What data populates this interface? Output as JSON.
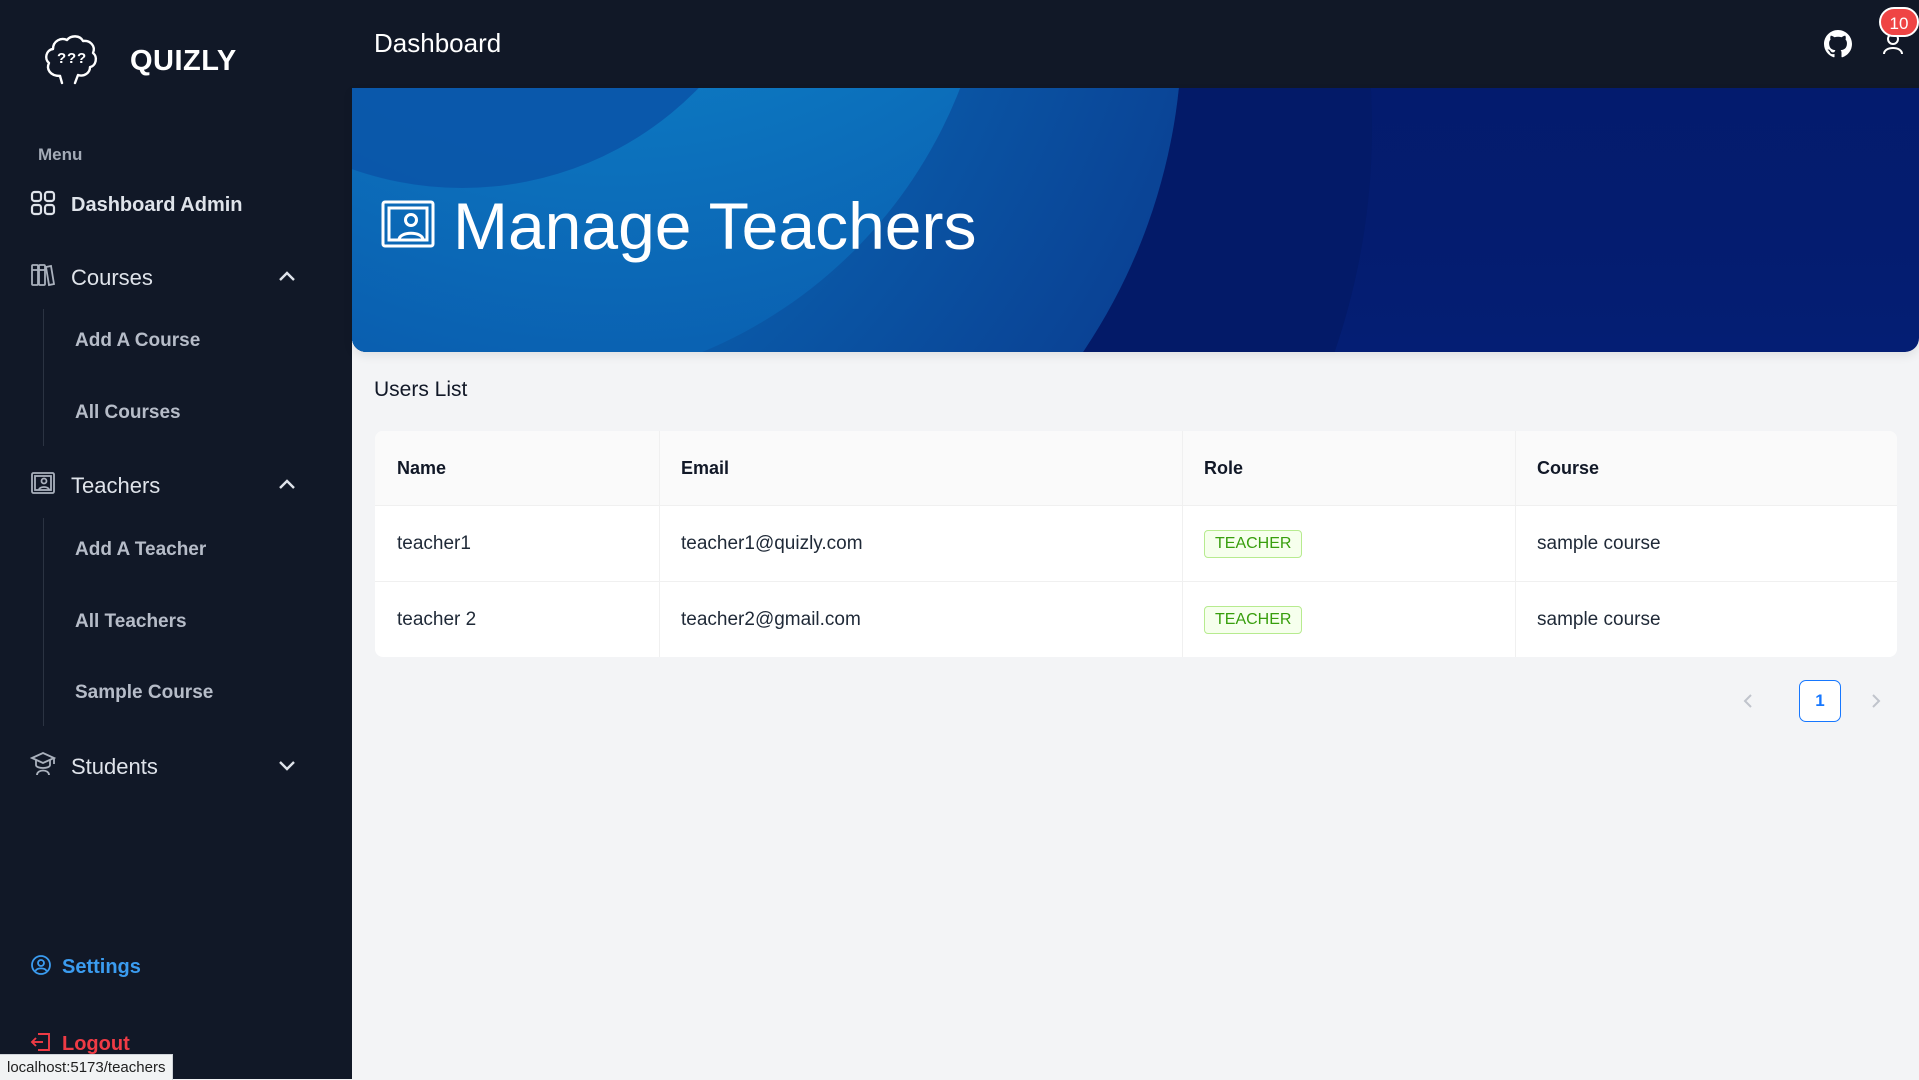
{
  "app": {
    "name": "QUIZLY"
  },
  "sidebar": {
    "menu_label": "Menu",
    "dashboard": "Dashboard Admin",
    "courses": {
      "label": "Courses",
      "items": [
        "Add A Course",
        "All Courses"
      ]
    },
    "teachers": {
      "label": "Teachers",
      "items": [
        "Add A Teacher",
        "All Teachers",
        "Sample Course"
      ]
    },
    "students": {
      "label": "Students"
    },
    "settings": "Settings",
    "logout": "Logout"
  },
  "header": {
    "title": "Dashboard",
    "notification_count": "10"
  },
  "banner": {
    "title": "Manage Teachers"
  },
  "users": {
    "title": "Users List",
    "columns": [
      "Name",
      "Email",
      "Role",
      "Course"
    ],
    "rows": [
      {
        "name": "teacher1",
        "email": "teacher1@quizly.com",
        "role": "TEACHER",
        "course": "sample course"
      },
      {
        "name": "teacher 2",
        "email": "teacher2@gmail.com",
        "role": "TEACHER",
        "course": "sample course"
      }
    ]
  },
  "pagination": {
    "current": "1"
  },
  "status_url": "localhost:5173/teachers",
  "colors": {
    "sidebar_bg": "#111827",
    "accent": "#1677ff",
    "role_tag": "#389e0d",
    "logout": "#ef3b45",
    "settings": "#3b9cf0",
    "badge": "#ef4444"
  }
}
